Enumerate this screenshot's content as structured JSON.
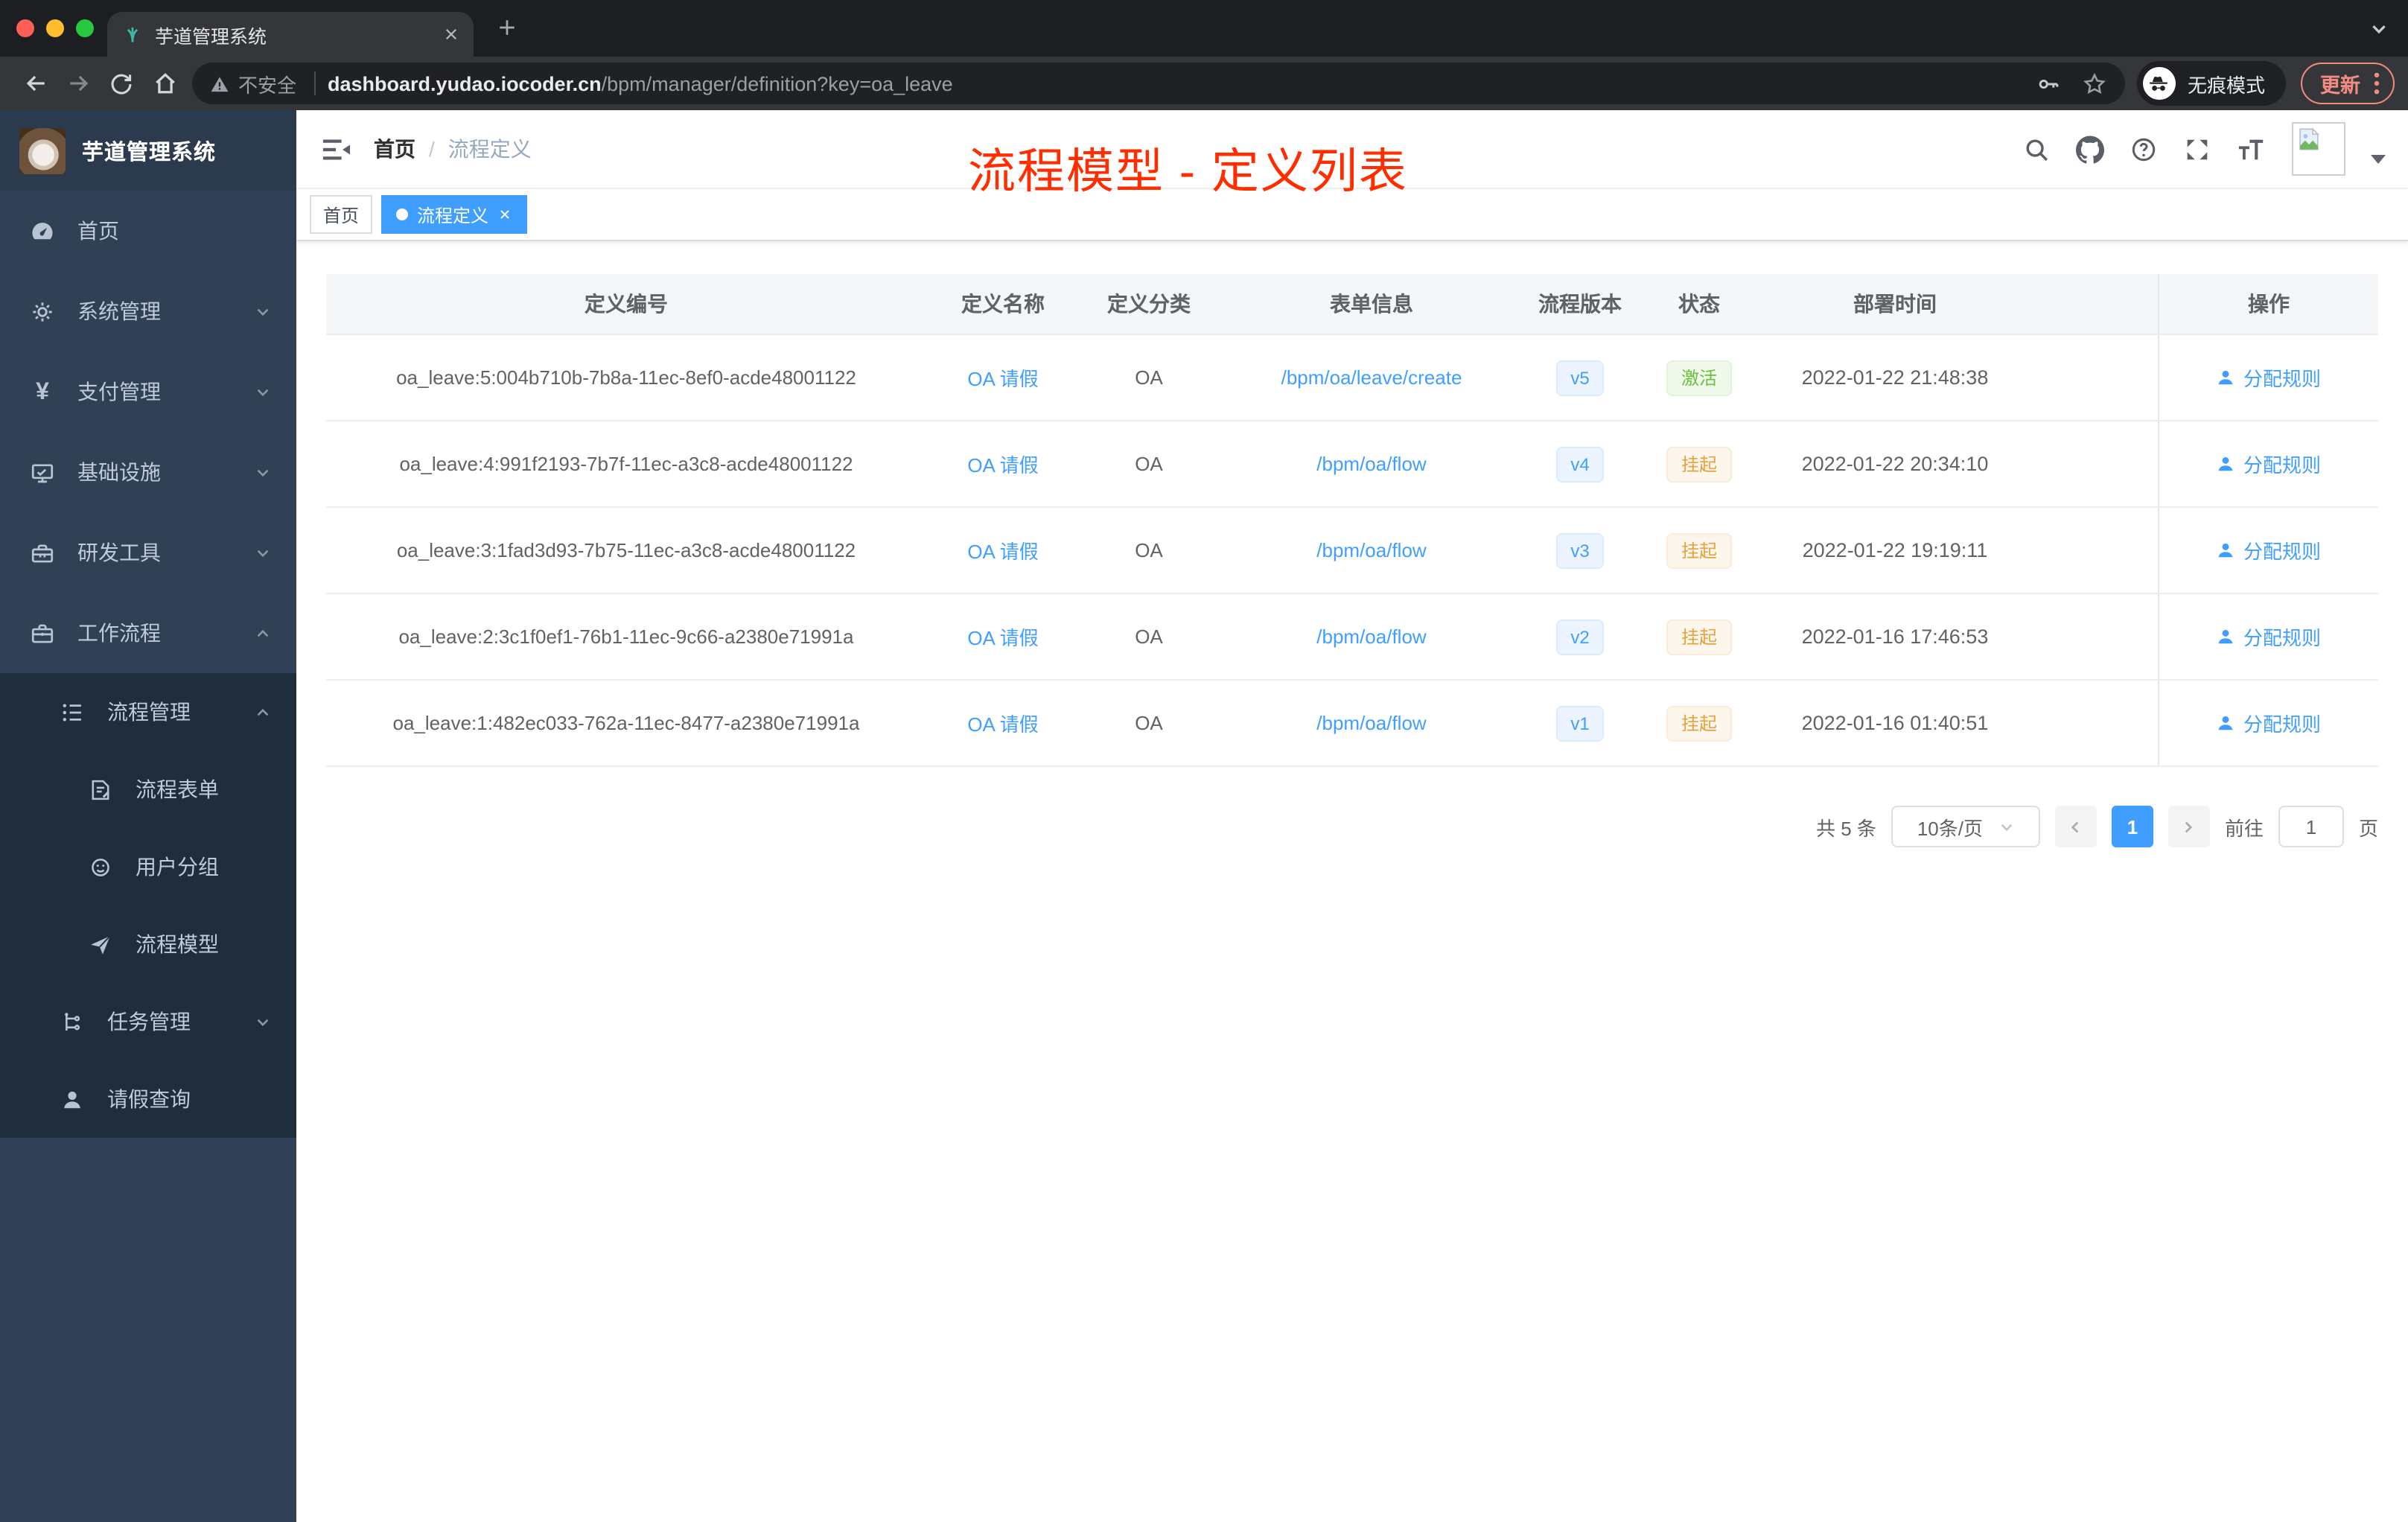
{
  "browser": {
    "tab_title": "芋道管理系统",
    "not_secure": "不安全",
    "url_domain": "dashboard.yudao.iocoder.cn",
    "url_path": "/bpm/manager/definition?key=oa_leave",
    "incognito": "无痕模式",
    "update": "更新"
  },
  "sidebar": {
    "logo_title": "芋道管理系统",
    "items": [
      {
        "label": "首页"
      },
      {
        "label": "系统管理"
      },
      {
        "label": "支付管理"
      },
      {
        "label": "基础设施"
      },
      {
        "label": "研发工具"
      },
      {
        "label": "工作流程"
      }
    ],
    "sub": [
      {
        "label": "流程管理"
      },
      {
        "label": "流程表单"
      },
      {
        "label": "用户分组"
      },
      {
        "label": "流程模型"
      },
      {
        "label": "任务管理"
      },
      {
        "label": "请假查询"
      }
    ]
  },
  "navbar": {
    "breadcrumb_home": "首页",
    "breadcrumb_sep": "/",
    "breadcrumb_current": "流程定义",
    "annotation": "流程模型 - 定义列表"
  },
  "tags": {
    "home": "首页",
    "active": "流程定义"
  },
  "table": {
    "columns": [
      "定义编号",
      "定义名称",
      "定义分类",
      "表单信息",
      "流程版本",
      "状态",
      "部署时间",
      "操作"
    ],
    "rows": [
      {
        "id": "oa_leave:5:004b710b-7b8a-11ec-8ef0-acde48001122",
        "name": "OA 请假",
        "category": "OA",
        "form": "/bpm/oa/leave/create",
        "version": "v5",
        "status": "激活",
        "time": "2022-01-22 21:48:38",
        "action": "分配规则"
      },
      {
        "id": "oa_leave:4:991f2193-7b7f-11ec-a3c8-acde48001122",
        "name": "OA 请假",
        "category": "OA",
        "form": "/bpm/oa/flow",
        "version": "v4",
        "status": "挂起",
        "time": "2022-01-22 20:34:10",
        "action": "分配规则"
      },
      {
        "id": "oa_leave:3:1fad3d93-7b75-11ec-a3c8-acde48001122",
        "name": "OA 请假",
        "category": "OA",
        "form": "/bpm/oa/flow",
        "version": "v3",
        "status": "挂起",
        "time": "2022-01-22 19:19:11",
        "action": "分配规则"
      },
      {
        "id": "oa_leave:2:3c1f0ef1-76b1-11ec-9c66-a2380e71991a",
        "name": "OA 请假",
        "category": "OA",
        "form": "/bpm/oa/flow",
        "version": "v2",
        "status": "挂起",
        "time": "2022-01-16 17:46:53",
        "action": "分配规则"
      },
      {
        "id": "oa_leave:1:482ec033-762a-11ec-8477-a2380e71991a",
        "name": "OA 请假",
        "category": "OA",
        "form": "/bpm/oa/flow",
        "version": "v1",
        "status": "挂起",
        "time": "2022-01-16 01:40:51",
        "action": "分配规则"
      }
    ]
  },
  "pagination": {
    "total": "共 5 条",
    "page_size": "10条/页",
    "current": "1",
    "goto": "前往",
    "goto_value": "1",
    "unit": "页"
  },
  "colors": {
    "primary": "#409eff",
    "success": "#67c23a",
    "warning": "#e6a23c",
    "annotation_red": "#ff2d00",
    "sidebar_bg": "#304156",
    "submenu_bg": "#1f2d3d"
  }
}
